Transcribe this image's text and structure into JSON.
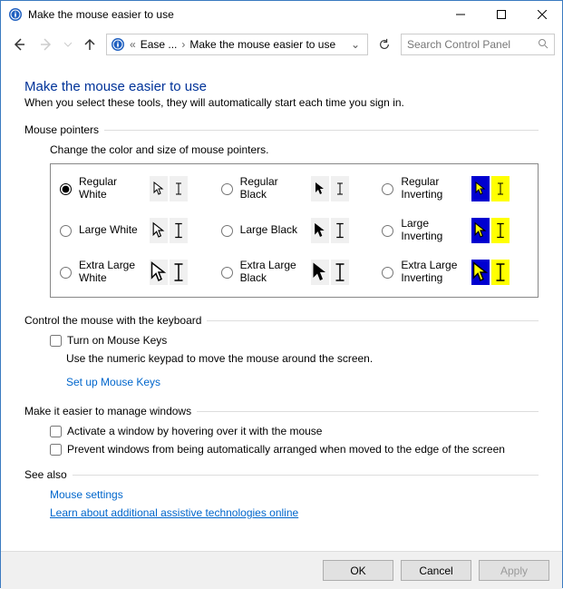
{
  "window": {
    "title": "Make the mouse easier to use"
  },
  "breadcrumb": {
    "seg1": "Ease ...",
    "seg2": "Make the mouse easier to use"
  },
  "search": {
    "placeholder": "Search Control Panel"
  },
  "page": {
    "title": "Make the mouse easier to use",
    "subtitle": "When you select these tools, they will automatically start each time you sign in."
  },
  "mousePointers": {
    "group": "Mouse pointers",
    "desc": "Change the color and size of mouse pointers.",
    "options": {
      "regWhite": "Regular White",
      "regBlack": "Regular Black",
      "regInv": "Regular Inverting",
      "lgWhite": "Large White",
      "lgBlack": "Large Black",
      "lgInv": "Large Inverting",
      "xlWhite": "Extra Large White",
      "xlBlack": "Extra Large Black",
      "xlInv": "Extra Large Inverting"
    }
  },
  "keyboardControl": {
    "group": "Control the mouse with the keyboard",
    "mouseKeys": "Turn on Mouse Keys",
    "help": "Use the numeric keypad to move the mouse around the screen.",
    "link": "Set up Mouse Keys"
  },
  "manageWindows": {
    "group": "Make it easier to manage windows",
    "hover": "Activate a window by hovering over it with the mouse",
    "snap": "Prevent windows from being automatically arranged when moved to the edge of the screen"
  },
  "seeAlso": {
    "group": "See also",
    "link1": "Mouse settings",
    "link2": "Learn about additional assistive technologies online"
  },
  "buttons": {
    "ok": "OK",
    "cancel": "Cancel",
    "apply": "Apply"
  }
}
